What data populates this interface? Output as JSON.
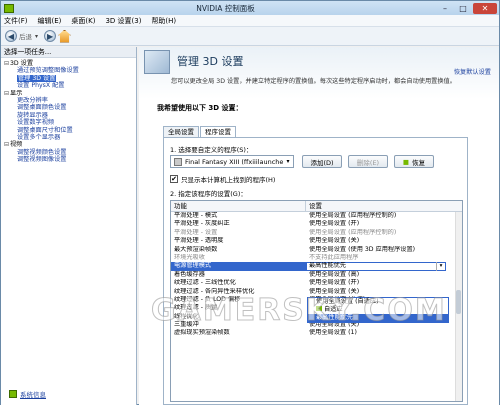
{
  "window": {
    "title": "NVIDIA 控制面板",
    "close_label": "✕",
    "min_label": "–",
    "max_label": "□"
  },
  "menu": [
    "文件(F)",
    "编辑(E)",
    "桌面(K)",
    "3D 设置(3)",
    "帮助(H)"
  ],
  "toolbar": {
    "back_label": "后退",
    "back_icon": "◀",
    "fwd_icon": "▶",
    "drop_icon": "▾"
  },
  "sidebar": {
    "header": "选择一项任务...",
    "tree": [
      {
        "label": "3D 设置",
        "level": 0,
        "expander": "⊟"
      },
      {
        "label": "通过预览调整图像设置",
        "level": 1
      },
      {
        "label": "管理 3D 设置",
        "level": 1,
        "selected": true
      },
      {
        "label": "设置 PhysX 配置",
        "level": 1
      },
      {
        "label": "显示",
        "level": 0,
        "expander": "⊟"
      },
      {
        "label": "更改分辨率",
        "level": 1
      },
      {
        "label": "调整桌面颜色设置",
        "level": 1
      },
      {
        "label": "旋转显示器",
        "level": 1
      },
      {
        "label": "设置数字视频",
        "level": 1
      },
      {
        "label": "调整桌面尺寸和位置",
        "level": 1
      },
      {
        "label": "设置多个显示器",
        "level": 1
      },
      {
        "label": "视频",
        "level": 0,
        "expander": "⊟"
      },
      {
        "label": "调整视频颜色设置",
        "level": 1
      },
      {
        "label": "调整视频图像设置",
        "level": 1
      }
    ],
    "system_info": "系统信息"
  },
  "main": {
    "title": "管理 3D 设置",
    "restore": "恢复默认设置",
    "description": "您可以更改全局 3D 设置，并建立特定程序的置换值。每次这些特定程序启动时，都会自动使用置换值。",
    "section_title": "我希望使用以下 3D 设置：",
    "tabs": [
      "全局设置",
      "程序设置"
    ],
    "label_select": "1. 选择要自定义的程序(S)：",
    "program": "Final Fantasy XIII (ffxiiilauncher.e...",
    "add_button": "添加(D)",
    "remove_button": "删除(E)",
    "restore_button": "恢复",
    "checkbox_label": "只显示本计算机上找到的程序(H)",
    "checkbox_checked": "✔",
    "label_settings": "2. 指定该程序的设置(G)：",
    "col_feature": "功能",
    "col_setting": "设置",
    "rows": [
      {
        "feature": "平滑处理 - 模式",
        "setting": "使用全局设置 (应用程序控制的)"
      },
      {
        "feature": "平滑处理 - 灰度纠正",
        "setting": "使用全局设置 (开)"
      },
      {
        "feature": "平滑处理 - 设置",
        "setting": "使用全局设置 (应用程序控制的)",
        "dim": true
      },
      {
        "feature": "平滑处理 - 透明度",
        "setting": "使用全局设置 (关)"
      },
      {
        "feature": "最大预渲染帧数",
        "setting": "使用全局设置 (使用 3D 应用程序设置)"
      },
      {
        "feature": "环境光吸收",
        "setting": "不支持此应用程序",
        "dim": true
      },
      {
        "feature": "电源管理模式",
        "setting": "最高性能优先",
        "highlight": true
      },
      {
        "feature": "着色缓存器",
        "setting": "使用全局设置 (高)"
      },
      {
        "feature": "纹理过滤 - 三线性优化",
        "setting": "使用全局设置 (开)"
      },
      {
        "feature": "纹理过滤 - 各向异性采样优化",
        "setting": "使用全局设置 (关)"
      },
      {
        "feature": "纹理过滤 - 负 LOD 偏移",
        "setting": "使用全局设置 (允许)"
      },
      {
        "feature": "纹理过滤 - 质量",
        "setting": "使用全局设置 (质量)"
      },
      {
        "feature": "线程优化",
        "setting": "使用全局设置 (自动)"
      },
      {
        "feature": "三重缓冲",
        "setting": "使用全局设置 (关)"
      },
      {
        "feature": "虚拟现实预渲染帧数",
        "setting": "使用全局设置 (1)"
      }
    ],
    "dropdown_options": [
      {
        "label": "使用全局设置 (自适应)",
        "selected": false,
        "check": false
      },
      {
        "label": "自适应",
        "selected": false,
        "check": true
      },
      {
        "label": "最高性能优先",
        "selected": true,
        "check": false
      }
    ]
  },
  "watermark": "GAMERSKY.COM"
}
